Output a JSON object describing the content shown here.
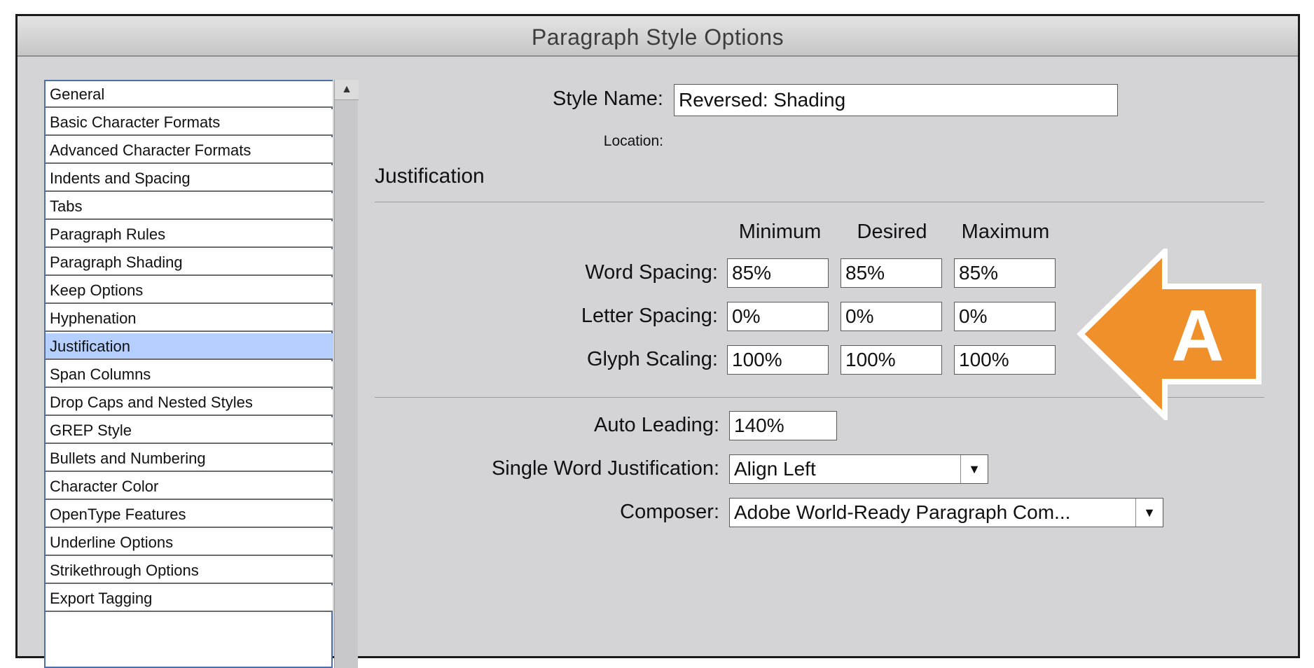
{
  "window": {
    "title": "Paragraph Style Options"
  },
  "sidebar": {
    "items": [
      {
        "label": "General"
      },
      {
        "label": "Basic Character Formats"
      },
      {
        "label": "Advanced Character Formats"
      },
      {
        "label": "Indents and Spacing"
      },
      {
        "label": "Tabs"
      },
      {
        "label": "Paragraph Rules"
      },
      {
        "label": "Paragraph Shading"
      },
      {
        "label": "Keep Options"
      },
      {
        "label": "Hyphenation"
      },
      {
        "label": "Justification",
        "selected": true
      },
      {
        "label": "Span Columns"
      },
      {
        "label": "Drop Caps and Nested Styles"
      },
      {
        "label": "GREP Style"
      },
      {
        "label": "Bullets and Numbering"
      },
      {
        "label": "Character Color"
      },
      {
        "label": "OpenType Features"
      },
      {
        "label": "Underline Options"
      },
      {
        "label": "Strikethrough Options"
      },
      {
        "label": "Export Tagging"
      }
    ]
  },
  "style_name": {
    "label": "Style Name:",
    "value": "Reversed: Shading"
  },
  "location": {
    "label": "Location:"
  },
  "section": {
    "title": "Justification"
  },
  "grid": {
    "headers": [
      "Minimum",
      "Desired",
      "Maximum"
    ],
    "rows": [
      {
        "label": "Word Spacing:",
        "values": [
          "85%",
          "85%",
          "85%"
        ]
      },
      {
        "label": "Letter Spacing:",
        "values": [
          "0%",
          "0%",
          "0%"
        ]
      },
      {
        "label": "Glyph Scaling:",
        "values": [
          "100%",
          "100%",
          "100%"
        ]
      }
    ]
  },
  "auto_leading": {
    "label": "Auto Leading:",
    "value": "140%"
  },
  "single_word": {
    "label": "Single Word Justification:",
    "value": "Align Left"
  },
  "composer": {
    "label": "Composer:",
    "value": "Adobe World-Ready Paragraph Com..."
  },
  "callout": {
    "letter": "A",
    "color": "#f0902a"
  },
  "icons": {
    "scroll_up": "triangle-up",
    "dropdown": "triangle-down"
  }
}
